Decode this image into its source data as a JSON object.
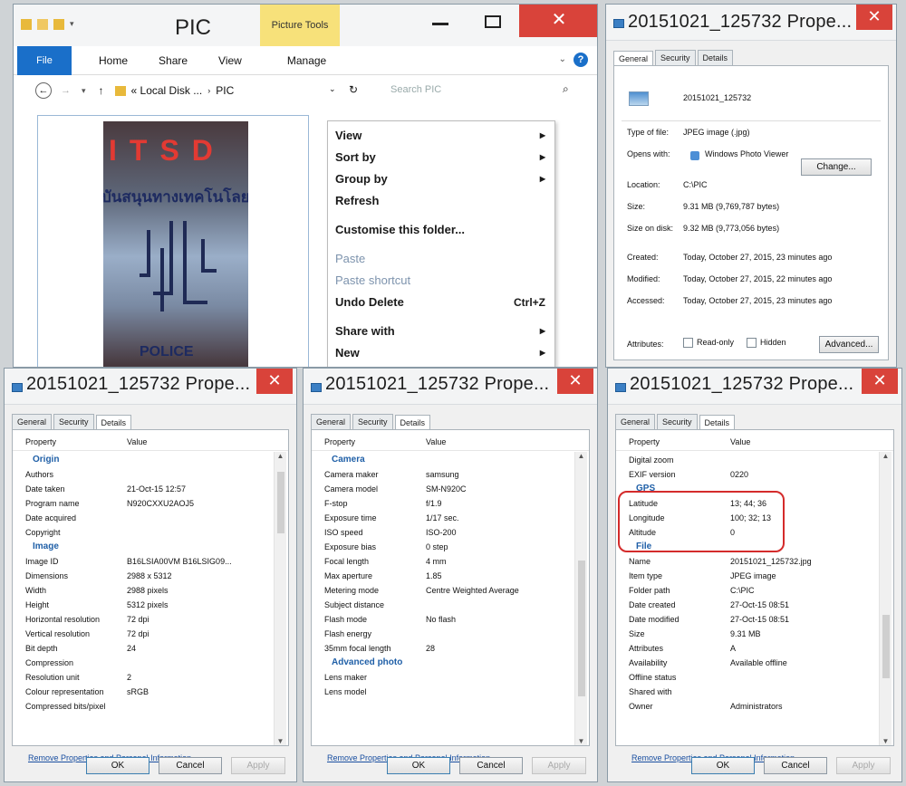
{
  "explorer": {
    "title": "PIC",
    "context_tab": "Picture Tools",
    "ribbon": [
      "File",
      "Home",
      "Share",
      "View",
      "Manage"
    ],
    "address": [
      "« Local Disk ...",
      "PIC"
    ],
    "search_placeholder": "Search PIC",
    "image": {
      "top_text": "ITSD",
      "thai_text": "บันสนุนทางเทคโนโลย",
      "bottom_text": "POLICE"
    },
    "context_menu": [
      {
        "label": "View",
        "arrow": true,
        "disabled": false,
        "shortcut": ""
      },
      {
        "label": "Sort by",
        "arrow": true,
        "disabled": false,
        "shortcut": ""
      },
      {
        "label": "Group by",
        "arrow": true,
        "disabled": false,
        "shortcut": ""
      },
      {
        "label": "Refresh",
        "arrow": false,
        "disabled": false,
        "shortcut": ""
      },
      {
        "label": "Customise this folder...",
        "arrow": false,
        "disabled": false,
        "shortcut": ""
      },
      {
        "label": "Paste",
        "arrow": false,
        "disabled": true,
        "shortcut": ""
      },
      {
        "label": "Paste shortcut",
        "arrow": false,
        "disabled": true,
        "shortcut": ""
      },
      {
        "label": "Undo Delete",
        "arrow": false,
        "disabled": false,
        "shortcut": "Ctrl+Z"
      },
      {
        "label": "Share with",
        "arrow": true,
        "disabled": false,
        "shortcut": ""
      },
      {
        "label": "New",
        "arrow": true,
        "disabled": false,
        "shortcut": ""
      }
    ]
  },
  "general": {
    "title": "20151021_125732 Prope...",
    "tabs": [
      "General",
      "Security",
      "Details"
    ],
    "file_name": "20151021_125732",
    "rows": [
      {
        "label": "Type of file:",
        "value": "JPEG image (.jpg)"
      },
      {
        "label": "Opens with:",
        "value": "Windows Photo Viewer"
      },
      {
        "label": "Location:",
        "value": "C:\\PIC"
      },
      {
        "label": "Size:",
        "value": "9.31 MB (9,769,787 bytes)"
      },
      {
        "label": "Size on disk:",
        "value": "9.32 MB (9,773,056 bytes)"
      },
      {
        "label": "Created:",
        "value": "Today, October 27, 2015, 23 minutes ago"
      },
      {
        "label": "Modified:",
        "value": "Today, October 27, 2015, 22 minutes ago"
      },
      {
        "label": "Accessed:",
        "value": "Today, October 27, 2015, 23 minutes ago"
      }
    ],
    "change_label": "Change...",
    "attributes_label": "Attributes:",
    "readonly_label": "Read-only",
    "hidden_label": "Hidden",
    "advanced_label": "Advanced..."
  },
  "details_common": {
    "title": "20151021_125732 Prope...",
    "tabs": [
      "General",
      "Security",
      "Details"
    ],
    "col_property": "Property",
    "col_value": "Value",
    "remove_link": "Remove Properties and Personal Information",
    "ok": "OK",
    "cancel": "Cancel",
    "apply": "Apply"
  },
  "details1": [
    {
      "section": "Origin"
    },
    {
      "label": "Authors",
      "value": ""
    },
    {
      "label": "Date taken",
      "value": "21-Oct-15 12:57"
    },
    {
      "label": "Program name",
      "value": "N920CXXU2AOJ5"
    },
    {
      "label": "Date acquired",
      "value": ""
    },
    {
      "label": "Copyright",
      "value": ""
    },
    {
      "section": "Image"
    },
    {
      "label": "Image ID",
      "value": "B16LSIA00VM B16LSIG09..."
    },
    {
      "label": "Dimensions",
      "value": "2988 x 5312"
    },
    {
      "label": "Width",
      "value": "2988 pixels"
    },
    {
      "label": "Height",
      "value": "5312 pixels"
    },
    {
      "label": "Horizontal resolution",
      "value": "72 dpi"
    },
    {
      "label": "Vertical resolution",
      "value": "72 dpi"
    },
    {
      "label": "Bit depth",
      "value": "24"
    },
    {
      "label": "Compression",
      "value": ""
    },
    {
      "label": "Resolution unit",
      "value": "2"
    },
    {
      "label": "Colour representation",
      "value": "sRGB"
    },
    {
      "label": "Compressed bits/pixel",
      "value": ""
    }
  ],
  "details2": [
    {
      "section": "Camera"
    },
    {
      "label": "Camera maker",
      "value": "samsung"
    },
    {
      "label": "Camera model",
      "value": "SM-N920C"
    },
    {
      "label": "F-stop",
      "value": "f/1.9"
    },
    {
      "label": "Exposure time",
      "value": "1/17 sec."
    },
    {
      "label": "ISO speed",
      "value": "ISO-200"
    },
    {
      "label": "Exposure bias",
      "value": "0 step"
    },
    {
      "label": "Focal length",
      "value": "4 mm"
    },
    {
      "label": "Max aperture",
      "value": "1.85"
    },
    {
      "label": "Metering mode",
      "value": "Centre Weighted Average"
    },
    {
      "label": "Subject distance",
      "value": ""
    },
    {
      "label": "Flash mode",
      "value": "No flash"
    },
    {
      "label": "Flash energy",
      "value": ""
    },
    {
      "label": "35mm focal length",
      "value": "28"
    },
    {
      "section": "Advanced photo"
    },
    {
      "label": "Lens maker",
      "value": ""
    },
    {
      "label": "Lens model",
      "value": ""
    }
  ],
  "details3": [
    {
      "label": "Digital zoom",
      "value": ""
    },
    {
      "label": "EXIF version",
      "value": "0220"
    },
    {
      "section": "GPS"
    },
    {
      "label": "Latitude",
      "value": "13; 44; 36"
    },
    {
      "label": "Longitude",
      "value": "100; 32; 13"
    },
    {
      "label": "Altitude",
      "value": "0"
    },
    {
      "section": "File"
    },
    {
      "label": "Name",
      "value": "20151021_125732.jpg"
    },
    {
      "label": "Item type",
      "value": "JPEG image"
    },
    {
      "label": "Folder path",
      "value": "C:\\PIC"
    },
    {
      "label": "Date created",
      "value": "27-Oct-15 08:51"
    },
    {
      "label": "Date modified",
      "value": "27-Oct-15 08:51"
    },
    {
      "label": "Size",
      "value": "9.31 MB"
    },
    {
      "label": "Attributes",
      "value": "A"
    },
    {
      "label": "Availability",
      "value": "Available offline"
    },
    {
      "label": "Offline status",
      "value": ""
    },
    {
      "label": "Shared with",
      "value": ""
    },
    {
      "label": "Owner",
      "value": "Administrators"
    }
  ],
  "colors": {
    "accent": "#1a6fc9",
    "close": "#d9433a",
    "context_tab": "#f7e17a",
    "highlight": "#d42b2b"
  }
}
